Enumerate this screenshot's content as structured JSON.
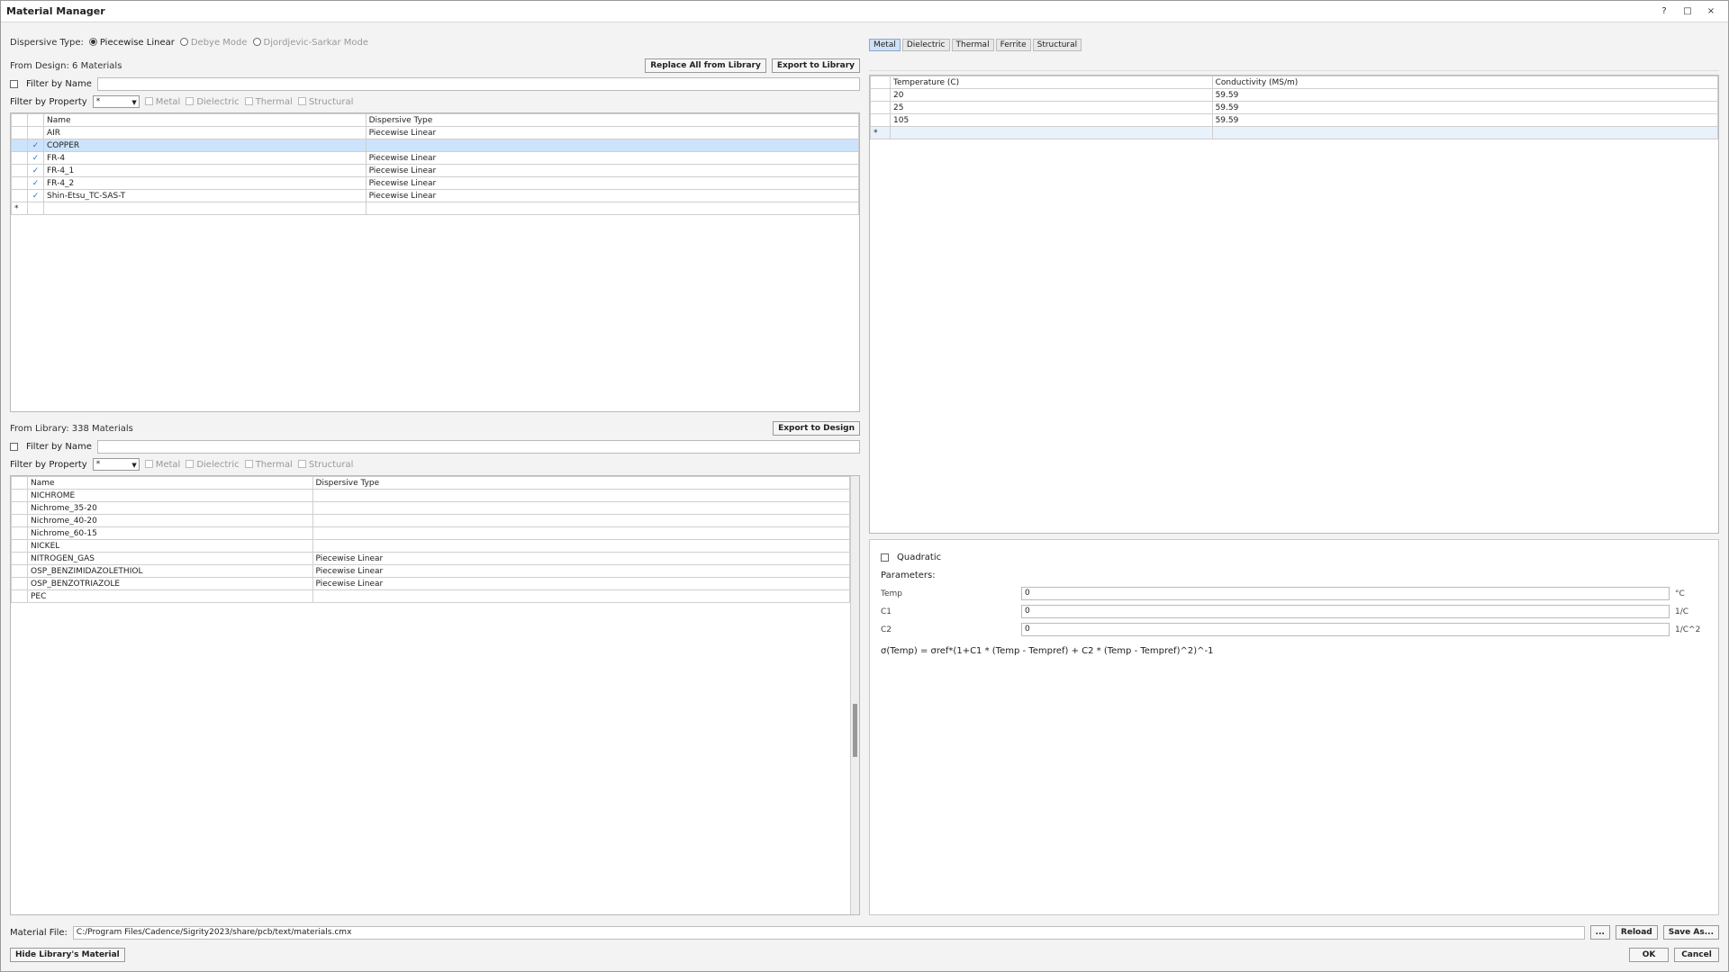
{
  "dialog": {
    "title": "Material Manager"
  },
  "titlebar_buttons": [
    "?",
    "□",
    "×"
  ],
  "dispersive": {
    "label": "Dispersive Type:",
    "options": [
      "Piecewise Linear",
      "Debye Mode",
      "Djordjevic-Sarkar Mode"
    ],
    "selected": 0
  },
  "design": {
    "label": "From Design: 6 Materials",
    "replace_btn": "Replace All from Library",
    "export_btn": "Export to Library",
    "filter_name_label": "Filter by Name",
    "filter_prop_label": "Filter by Property",
    "filter_value": "*",
    "prop_checks": [
      "Metal",
      "Dielectric",
      "Thermal",
      "Structural"
    ],
    "columns": [
      "Name",
      "Dispersive Type"
    ],
    "rows": [
      {
        "name": "AIR",
        "type": "Piecewise Linear",
        "checked": false,
        "selected": false
      },
      {
        "name": "COPPER",
        "type": "",
        "checked": true,
        "selected": true
      },
      {
        "name": "FR-4",
        "type": "Piecewise Linear",
        "checked": true,
        "selected": false
      },
      {
        "name": "FR-4_1",
        "type": "Piecewise Linear",
        "checked": true,
        "selected": false
      },
      {
        "name": "FR-4_2",
        "type": "Piecewise Linear",
        "checked": true,
        "selected": false
      },
      {
        "name": "Shin-Etsu_TC-SAS-T",
        "type": "Piecewise Linear",
        "checked": true,
        "selected": false
      }
    ],
    "new_row_marker": "*"
  },
  "library": {
    "label": "From Library: 338 Materials",
    "export_btn": "Export to Design",
    "filter_name_label": "Filter by Name",
    "filter_prop_label": "Filter by Property",
    "filter_value": "*",
    "prop_checks": [
      "Metal",
      "Dielectric",
      "Thermal",
      "Structural"
    ],
    "columns": [
      "Name",
      "Dispersive Type"
    ],
    "rows": [
      {
        "name": "NICHROME",
        "type": ""
      },
      {
        "name": "Nichrome_35-20",
        "type": ""
      },
      {
        "name": "Nichrome_40-20",
        "type": ""
      },
      {
        "name": "Nichrome_60-15",
        "type": ""
      },
      {
        "name": "NICKEL",
        "type": ""
      },
      {
        "name": "NITROGEN_GAS",
        "type": "Piecewise Linear"
      },
      {
        "name": "OSP_BENZIMIDAZOLETHIOL",
        "type": "Piecewise Linear"
      },
      {
        "name": "OSP_BENZOTRIAZOLE",
        "type": "Piecewise Linear"
      },
      {
        "name": "PEC",
        "type": ""
      }
    ]
  },
  "prop_tabs": {
    "items": [
      "Metal",
      "Dielectric",
      "Thermal",
      "Ferrite",
      "Structural"
    ],
    "active": 0
  },
  "cond_table": {
    "columns": [
      "Temperature (C)",
      "Conductivity (MS/m)"
    ],
    "rows": [
      [
        "20",
        "59.59"
      ],
      [
        "25",
        "59.59"
      ],
      [
        "105",
        "59.59"
      ]
    ],
    "new_row_marker": "*"
  },
  "quadratic": {
    "label": "Quadratic",
    "params_label": "Parameters:",
    "params": [
      {
        "label": "Temp",
        "value": "0",
        "unit": "°C"
      },
      {
        "label": "C1",
        "value": "0",
        "unit": "1/C"
      },
      {
        "label": "C2",
        "value": "0",
        "unit": "1/C^2"
      }
    ],
    "formula": "σ(Temp) = σref*(1+C1 * (Temp - Tempref) + C2 * (Temp - Tempref)^2)^-1"
  },
  "footer": {
    "file_label": "Material File:",
    "file_path": "C:/Program Files/Cadence/Sigrity2023/share/pcb/text/materials.cmx",
    "browse": "...",
    "reload": "Reload",
    "save_as": "Save As...",
    "hide_btn": "Hide Library's Material",
    "ok": "OK",
    "cancel": "Cancel"
  }
}
